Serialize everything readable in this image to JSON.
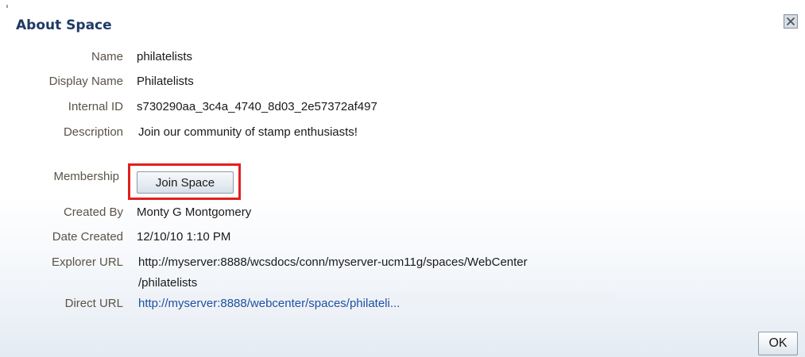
{
  "dialog": {
    "title": "About Space",
    "close_icon": "close-icon"
  },
  "fields": {
    "name": {
      "label": "Name",
      "value": "philatelists"
    },
    "display_name": {
      "label": "Display Name",
      "value": "Philatelists"
    },
    "internal_id": {
      "label": "Internal ID",
      "value": "s730290aa_3c4a_4740_8d03_2e57372af497"
    },
    "description": {
      "label": "Description",
      "value": "Join our community of stamp enthusiasts!"
    },
    "membership": {
      "label": "Membership",
      "button_label": "Join Space"
    },
    "created_by": {
      "label": "Created By",
      "value": "Monty G Montgomery"
    },
    "date_created": {
      "label": "Date Created",
      "value": "12/10/10 1:10 PM"
    },
    "explorer_url": {
      "label": "Explorer URL",
      "line1": "http://myserver:8888/wcsdocs/conn/myserver-ucm11g/spaces/WebCenter",
      "line2": "/philatelists"
    },
    "direct_url": {
      "label": "Direct URL",
      "value": "http://myserver:8888/webcenter/spaces/philateli..."
    }
  },
  "footer": {
    "ok_label": "OK"
  },
  "colors": {
    "title": "#1f3a66",
    "label": "#5a5347",
    "link": "#1f4fa3",
    "highlight": "#e0201f"
  }
}
